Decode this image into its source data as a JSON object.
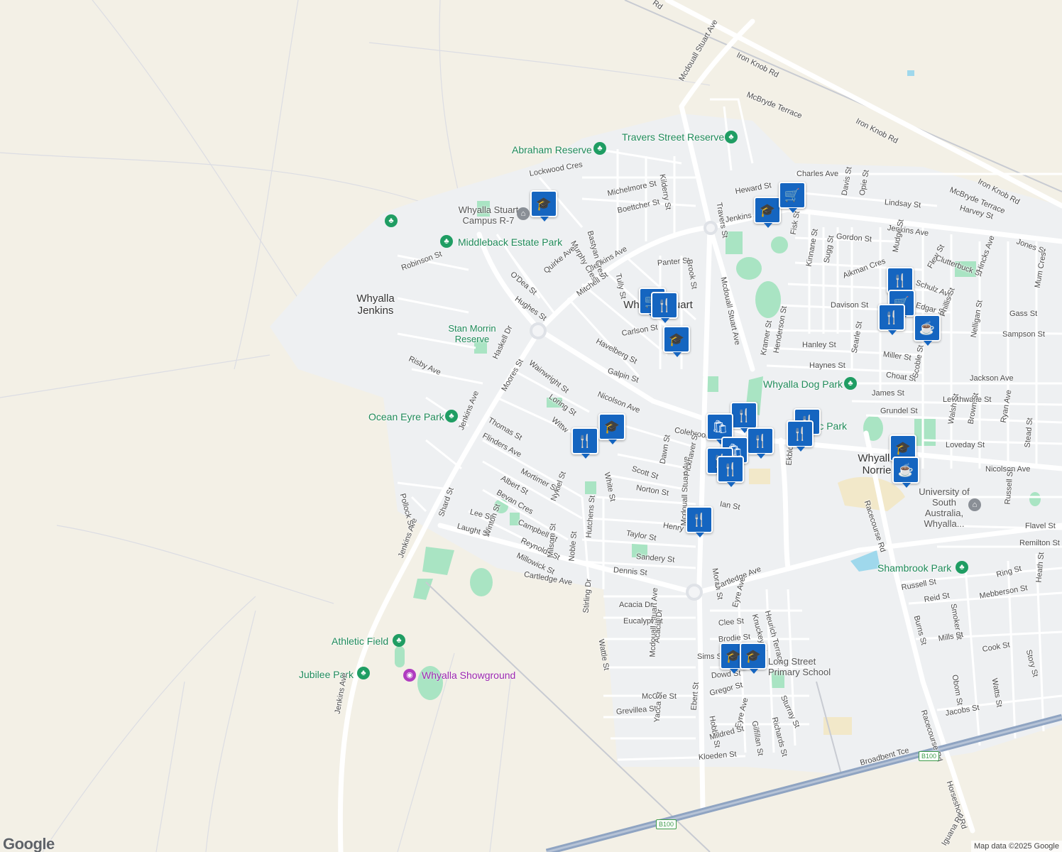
{
  "map": {
    "attribution": "Map data ©2025 Google",
    "logo": "Google",
    "places": {
      "jenkins_1": "Whyalla",
      "jenkins_2": "Jenkins",
      "stuart": "Whyalla Stuart",
      "norrie_1": "Whyalla",
      "norrie_2": "Norrie"
    },
    "pois": {
      "campus_1": "Whyalla Stuart",
      "campus_2": "Campus R-7",
      "stan_1": "Stan Morrin",
      "stan_2": "Reserve",
      "uni_1": "University of",
      "uni_2": "South",
      "uni_3": "Australia,",
      "uni_4": "Whyalla...",
      "long_1": "Long Street",
      "long_2": "Primary School",
      "showground": "Whyalla Showground"
    },
    "parks": {
      "travers": "Travers Street Reserve",
      "abraham": "Abraham Reserve",
      "middleback": "Middleback Estate Park",
      "ocean": "Ocean Eyre Park",
      "dog": "Whyalla Dog Park",
      "civic": "Civic Park",
      "shambrook": "Shambrook Park",
      "athletic": "Athletic Field",
      "jubilee": "Jubilee Park"
    },
    "streets": {
      "iron_knob_1": "Iron Knob Rd",
      "iron_knob_2": "Iron Knob Rd",
      "iron_knob_3": "Iron Knob Rd",
      "rd_top": "Rd",
      "mcdouall_1": "Mcdouall Stuart Ave",
      "mcdouall_2": "Mcdouall Stuart Ave",
      "mcdouall_3": "Mcdouall Stuart Ave",
      "mcdouall_4": "Mcdouall Stuart Ave",
      "mcbryde_1": "McBryde Terrace",
      "mcbryde_2": "McBryde Terrace",
      "charles": "Charles Ave",
      "heward": "Heward St",
      "davis": "Davis St",
      "opie": "Opie St",
      "lindsay": "Lindsay St",
      "harvey": "Harvey St",
      "jones": "Jones St",
      "jenkins_ave_1": "Jenkins Ave",
      "jenkins_ave_2": "Jenkins Ave",
      "jenkins_ave_3": "Jenkins Ave",
      "jenkins_ave_4": "Jenkins Ave",
      "jenkins_ave_5": "Jenkins Ave",
      "jenkins_ave_6": "Jenkins Ave",
      "travers": "Travers St",
      "gordon": "Gordon St",
      "fisk": "Fisk St",
      "kinnane": "Kinnane St",
      "sugg": "Sugg St",
      "aikman": "Aikman Cres",
      "mudge": "Mudge St",
      "schulz": "Schulz Ave",
      "flew": "Flew St",
      "clutterbuck": "Clutterbuck St",
      "hincks": "Hincks Ave",
      "mum": "Mum Cres",
      "edgar": "Edgar St",
      "phillis": "Phillis St",
      "davison": "Davison St",
      "gass": "Gass St",
      "sampson": "Sampson St",
      "nelligan": "Nelligan St",
      "hanley": "Hanley St",
      "kramer": "Kramer St",
      "henderson": "Henderson St",
      "searle": "Searle St",
      "miller": "Miller St",
      "haynes": "Haynes St",
      "choat": "Choat St",
      "scoble": "Scoble St",
      "jackson": "Jackson Ave",
      "james": "James St",
      "lewthwaite": "Lewthwaite St",
      "grundel": "Grundel St",
      "walsh": "Walsh St",
      "brown": "Brown St",
      "ryan": "Ryan Ave",
      "stead": "Stead St",
      "loveday": "Loveday St",
      "nicolson_1": "Nicolson Ave",
      "nicolson_2": "Nicolson Ave",
      "russell": "Russell St",
      "flavel": "Flavel St",
      "remilton": "Remilton St",
      "ring": "Ring St",
      "heath": "Heath St",
      "russell2": "Russell St",
      "reid": "Reid St",
      "smoker": "Smoker St",
      "mebberson": "Mebberson St",
      "burns": "Burns St",
      "mills": "Mills St",
      "cook": "Cook St",
      "story": "Story St",
      "obom": "Obom St",
      "watts": "Watts St",
      "jacobs": "Jacobs St",
      "racecourse_1": "Racecourse Rd",
      "racecourse_2": "Racecourse Rd",
      "horseshoe": "Horseshoe Rd",
      "iguana": "Iguana Rd",
      "broadbent": "Broadbent Tce",
      "lockwood": "Lockwood Cres",
      "michelmore": "Michelmore St",
      "kilderry": "Kilderry St",
      "boettcher": "Boettcher St",
      "bastyan": "Bastyan Cres",
      "murphy": "Murphy Cres",
      "quirke": "Quirke Ave",
      "odea": "O'Dea St",
      "hughes": "Hughes St",
      "mitchell": "Mitchell St",
      "tully": "Tully St",
      "panter": "Panter St",
      "brook": "Brook St",
      "carlson": "Carlson St",
      "havelberg": "Havelberg St",
      "galpin": "Galpin St",
      "robinson": "Robinson St",
      "risby": "Risby Ave",
      "haskell": "Haskell Dr",
      "wainwright": "Wainwright St",
      "moores": "Moores St",
      "loring": "Loring St",
      "thomas": "Thomas St",
      "flinders": "Flinders Ave",
      "wittw": "Wittw",
      "colebrook": "Colebrook",
      "dawn": "Dawn St",
      "scott": "Scott St",
      "white": "White St",
      "pickhaver": "Pickhaver St",
      "mortimer": "Mortimer St",
      "nykiel": "Nykiel St",
      "norton": "Norton St",
      "ian": "Ian St",
      "albert": "Albert St",
      "bevan": "Bevan Cres",
      "henry": "Henry St",
      "ekblom": "Ekblom St",
      "pollock": "Pollock St",
      "shard": "Shard St",
      "lee": "Lee St",
      "laught": "Laught St",
      "winton": "Winton St",
      "campbell": "Campbell St",
      "reynolds": "Reynolds St",
      "millowick": "Millowick St",
      "milsom": "Milsom St",
      "noble": "Noble St",
      "hutchens": "Hutchens St",
      "taylor": "Taylor St",
      "sandery": "Sandery St",
      "dennis": "Dennis St",
      "moran": "Moran St",
      "cartledge_1": "Cartledge Ave",
      "cartledge_2": "Cartledge Ave",
      "heurich": "Heurich Terrace",
      "eyre_1": "Eyre Ave",
      "knuckey": "Knuckey St",
      "stirling": "Stirling Dr",
      "acacia_dr": "Acacia Dr",
      "eucalypt": "Eucalypt St",
      "wattle": "Wattle St",
      "acacia": "Acacia Dr",
      "clee": "Clee St",
      "brodie": "Brodie St",
      "sims": "Sims St",
      "dowd": "Dowd St",
      "gregor": "Gregor St",
      "hobbs": "Hobbs St",
      "ebert": "Ebert St",
      "mcgee": "McGee St",
      "grevillea": "Grevillea St",
      "yacca": "Yacca St",
      "sturray": "Sturray St",
      "richards": "Richards St",
      "gilfillan": "Gilfillan St",
      "eyre_2": "Eyre Ave",
      "mildred": "Mildred St",
      "kloeden": "Kloeden St"
    },
    "shields": {
      "b100_1": "B100",
      "b100_2": "B100"
    },
    "colors": {
      "land": "#f3f0e6",
      "urban": "#eef0f2",
      "road": "#ffffff",
      "highway": "#8fa4c2",
      "park": "#a9e4c3",
      "water": "#9fd8ec",
      "pin": "#1565c0",
      "park_text": "#1f8a59"
    }
  }
}
